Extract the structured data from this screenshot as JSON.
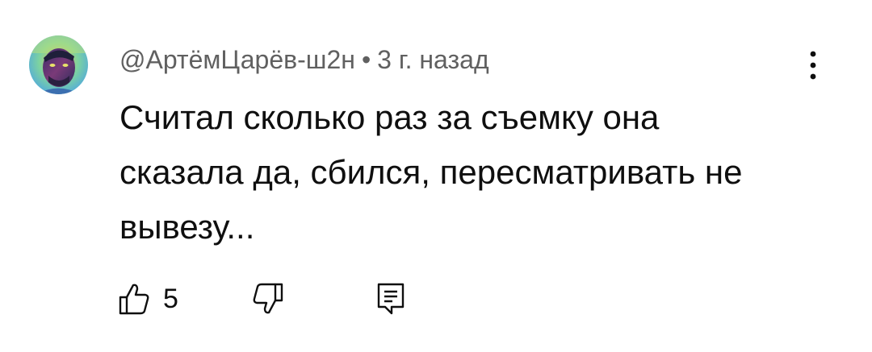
{
  "comment": {
    "author": "@АртёмЦарёв-ш2н",
    "separator": "•",
    "time": "3 г. назад",
    "text": "Считал сколько раз за съемку она\nсказала да, сбился, пересматривать не\nвывезу...",
    "likes": "5"
  },
  "icons": {
    "avatar": "user-avatar",
    "menu": "more-vertical-icon",
    "like": "thumb-up-icon",
    "dislike": "thumb-down-icon",
    "reply": "reply-comment-icon"
  },
  "colors": {
    "text": "#0f0f0f",
    "secondary": "#606060"
  }
}
